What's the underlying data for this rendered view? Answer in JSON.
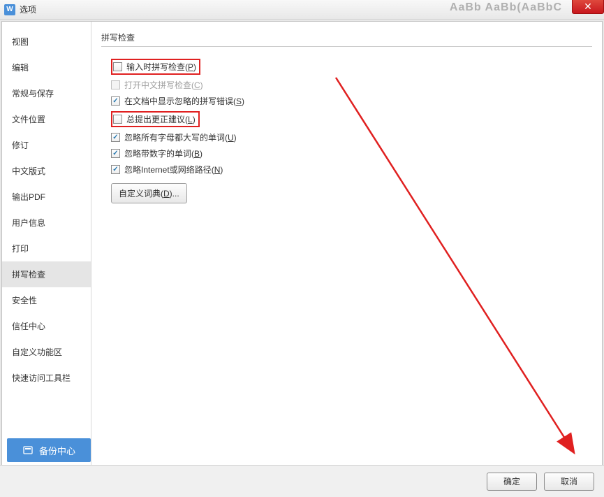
{
  "window": {
    "title": "选项",
    "app_icon_letter": "W",
    "faded_text": "AaBb AaBb(AaBbC"
  },
  "sidebar": {
    "items": [
      {
        "label": "视图"
      },
      {
        "label": "编辑"
      },
      {
        "label": "常规与保存"
      },
      {
        "label": "文件位置"
      },
      {
        "label": "修订"
      },
      {
        "label": "中文版式"
      },
      {
        "label": "输出PDF"
      },
      {
        "label": "用户信息"
      },
      {
        "label": "打印"
      },
      {
        "label": "拼写检查",
        "selected": true
      },
      {
        "label": "安全性"
      },
      {
        "label": "信任中心"
      },
      {
        "label": "自定义功能区"
      },
      {
        "label": "快速访问工具栏"
      }
    ]
  },
  "content": {
    "section_title": "拼写检查",
    "options": [
      {
        "label_pre": "输入时拼写检查(",
        "hotkey": "P",
        "label_post": ")",
        "checked": false,
        "highlighted": true
      },
      {
        "label_pre": "打开中文拼写检查(",
        "hotkey": "C",
        "label_post": ")",
        "checked": false,
        "disabled": true
      },
      {
        "label_pre": "在文档中显示忽略的拼写错误(",
        "hotkey": "S",
        "label_post": ")",
        "checked": true
      },
      {
        "label_pre": "总提出更正建议(",
        "hotkey": "L",
        "label_post": ")",
        "checked": false,
        "highlighted": true
      },
      {
        "label_pre": "忽略所有字母都大写的单词(",
        "hotkey": "U",
        "label_post": ")",
        "checked": true
      },
      {
        "label_pre": "忽略带数字的单词(",
        "hotkey": "B",
        "label_post": ")",
        "checked": true
      },
      {
        "label_pre": "忽略Internet或网络路径(",
        "hotkey": "N",
        "label_post": ")",
        "checked": true
      }
    ],
    "custom_dict_btn_pre": "自定义词典(",
    "custom_dict_btn_hotkey": "D",
    "custom_dict_btn_post": ")..."
  },
  "backup_center": {
    "label": "备份中心"
  },
  "buttons": {
    "ok": "确定",
    "cancel": "取消"
  }
}
